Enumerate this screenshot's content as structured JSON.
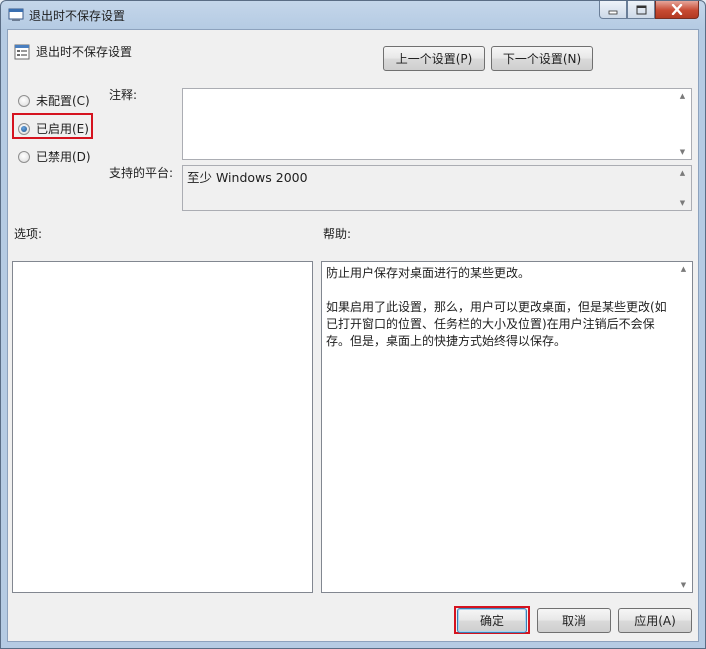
{
  "window": {
    "title": "退出时不保存设置",
    "minimize_icon": "minimize-icon",
    "maximize_icon": "maximize-icon",
    "close_icon": "close-icon"
  },
  "header": {
    "setting_name": "退出时不保存设置",
    "prev_button": "上一个设置(P)",
    "next_button": "下一个设置(N)"
  },
  "state": {
    "options": [
      {
        "label": "未配置(C)",
        "selected": false
      },
      {
        "label": "已启用(E)",
        "selected": true
      },
      {
        "label": "已禁用(D)",
        "selected": false
      }
    ]
  },
  "comment": {
    "label": "注释:",
    "value": ""
  },
  "platform": {
    "label": "支持的平台:",
    "value": "至少 Windows 2000"
  },
  "options_panel": {
    "label": "选项:"
  },
  "help_panel": {
    "label": "帮助:",
    "paragraph1": "防止用户保存对桌面进行的某些更改。",
    "paragraph2": "如果启用了此设置，那么，用户可以更改桌面，但是某些更改(如已打开窗口的位置、任务栏的大小及位置)在用户注销后不会保存。但是，桌面上的快捷方式始终得以保存。"
  },
  "footer": {
    "ok_button": "确定",
    "cancel_button": "取消",
    "apply_button": "应用(A)"
  },
  "colors": {
    "highlight": "#d5131f",
    "accent": "#3c7fb1"
  }
}
